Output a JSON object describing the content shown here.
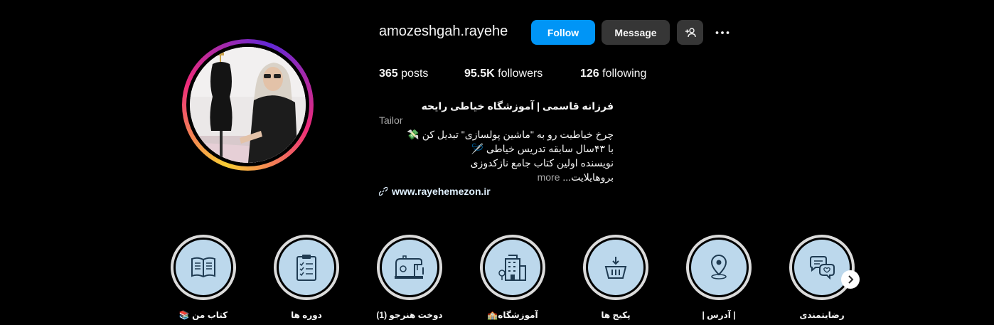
{
  "profile": {
    "username": "amozeshgah.rayehe",
    "follow_label": "Follow",
    "message_label": "Message",
    "add_user_icon": "add-user-icon",
    "more_icon": "more-options-icon",
    "stats": {
      "posts_count": "365",
      "posts_label": "posts",
      "followers_count": "95.5K",
      "followers_label": "followers",
      "following_count": "126",
      "following_label": "following"
    },
    "bio": {
      "name": "فرزانه قاسمی | آموزشگاه خیاطی رایحه",
      "category": "Tailor",
      "line1": "چرخ خیاطیت رو به \"ماشین پولسازی\" تبدیل کن 💸",
      "line2": "با ۴۳سال سابقه تدریس خیاطی 🪡",
      "line3": "نویسنده اولین کتاب جامع نازکدوزی",
      "line4": "بروهایلایت...",
      "more": "more",
      "link": "www.rayehemezon.ir"
    }
  },
  "highlights": [
    {
      "label": "کتاب من 📚",
      "icon": "book-icon"
    },
    {
      "label": "دوره ها",
      "icon": "clipboard-checklist-icon"
    },
    {
      "label": "دوخت هنرجو (1)",
      "icon": "sewing-machine-icon"
    },
    {
      "label": "آموزشگاه🏫",
      "icon": "building-icon"
    },
    {
      "label": "پکیج ها",
      "icon": "basket-icon"
    },
    {
      "label": "| آدرس |",
      "icon": "location-pin-icon"
    },
    {
      "label": "رضایتمندی",
      "icon": "chat-heart-icon"
    }
  ],
  "colors": {
    "background": "#000000",
    "follow_button": "#0095f6",
    "secondary_button": "#363636",
    "highlight_fill": "#bcd8ec"
  }
}
